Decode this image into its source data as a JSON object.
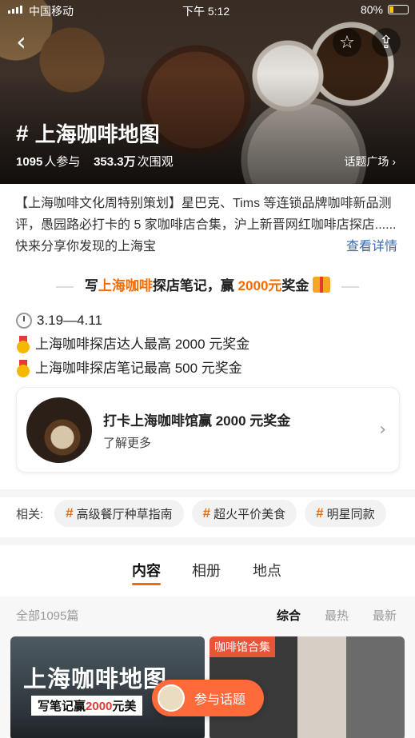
{
  "status_bar": {
    "carrier": "中国移动",
    "time": "下午 5:12",
    "battery": "80%"
  },
  "header": {
    "title": "上海咖啡地图",
    "participants": "1095",
    "participants_suffix": "人参与",
    "views": "353.3万",
    "views_suffix": "次围观",
    "topic_plaza": "话题广场",
    "icons": {
      "back": "back-arrow-icon",
      "favorite": "star-icon",
      "share": "share-icon"
    }
  },
  "description": {
    "text": "【上海咖啡文化周特别策划】星巴克、Tims 等连锁品牌咖啡新品测评，愚园路必打卡的 5 家咖啡店合集，沪上新晋网红咖啡店探店......快来分享你发现的上海宝",
    "more_label": "查看详情"
  },
  "promo": {
    "prefix": "写",
    "highlight": "上海咖啡",
    "middle": "探店笔记，赢 ",
    "amount": "2000元",
    "suffix": "奖金"
  },
  "rules": [
    {
      "icon": "clock-icon",
      "text": "3.19—4.11"
    },
    {
      "icon": "medal-icon",
      "text": "上海咖啡探店达人最高 2000 元奖金"
    },
    {
      "icon": "medal-icon",
      "text": "上海咖啡探店笔记最高 500 元奖金"
    }
  ],
  "promo_card": {
    "title": "打卡上海咖啡馆赢 2000 元奖金",
    "subtitle": "了解更多"
  },
  "related": {
    "label": "相关:",
    "chips": [
      "高级餐厅种草指南",
      "超火平价美食",
      "明星同款"
    ]
  },
  "tabs": [
    "内容",
    "相册",
    "地点"
  ],
  "active_tab": 0,
  "filter": {
    "count_label": "全部1095篇",
    "options": [
      "综合",
      "最热",
      "最新"
    ],
    "active": 0
  },
  "tiles": [
    {
      "headline": "上海咖啡地图",
      "sub_prefix": "写笔记赢",
      "sub_amount": "2000",
      "sub_suffix": "元美"
    },
    {
      "tag": "咖啡馆合集"
    }
  ],
  "fab": {
    "label": "参与话题"
  },
  "colors": {
    "accent": "#f56b00",
    "link": "#3a6aa8",
    "fab": "#ff6a3a"
  }
}
